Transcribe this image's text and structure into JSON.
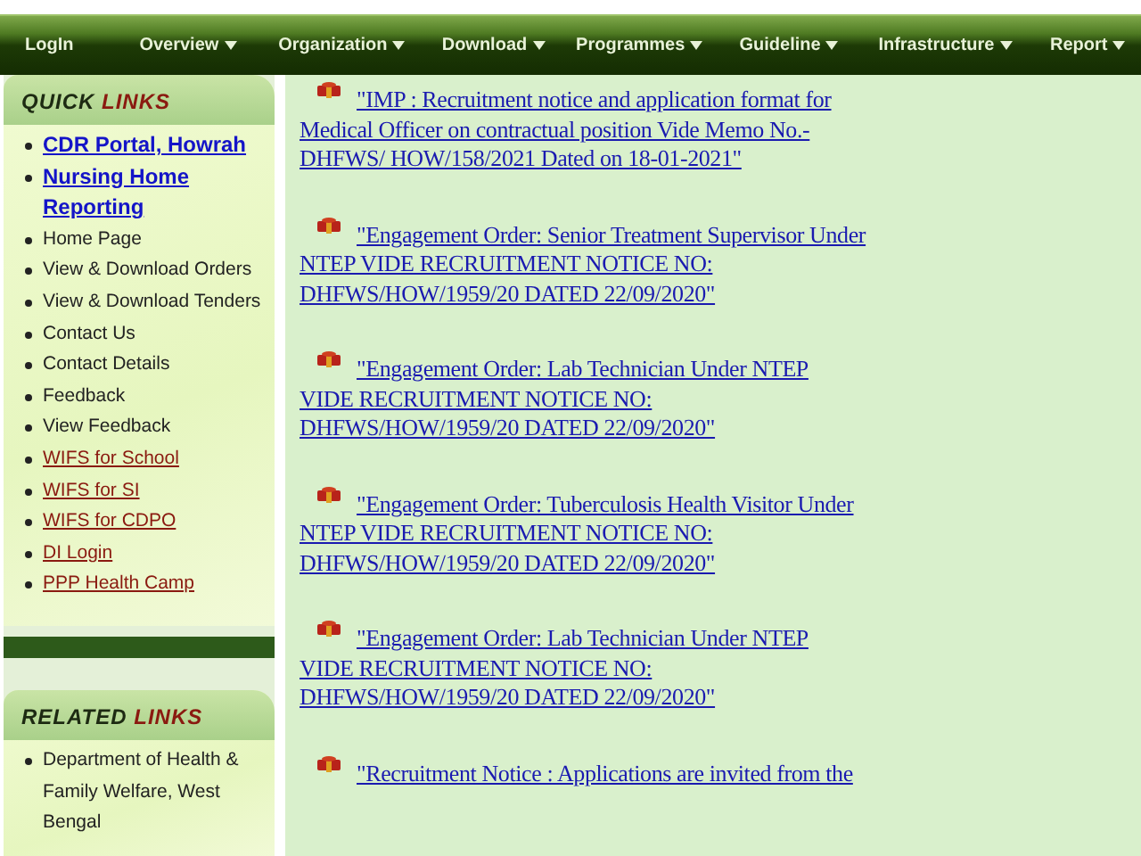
{
  "menu": [
    {
      "label": "LogIn",
      "has_dropdown": false
    },
    {
      "label": "Overview",
      "has_dropdown": true
    },
    {
      "label": "Organization",
      "has_dropdown": true
    },
    {
      "label": "Download",
      "has_dropdown": true
    },
    {
      "label": "Programmes",
      "has_dropdown": true
    },
    {
      "label": "Guideline",
      "has_dropdown": true
    },
    {
      "label": "Infrastructure",
      "has_dropdown": true
    },
    {
      "label": "Report",
      "has_dropdown": true
    }
  ],
  "quick_links": {
    "title": [
      "QUICK",
      "LINKS"
    ],
    "items": [
      {
        "label": "CDR Portal, Howrah",
        "kind": "blue"
      },
      {
        "label": "Nursing Home Reporting",
        "kind": "blue"
      },
      {
        "label": "Home Page",
        "kind": "plain"
      },
      {
        "label": "View & Download Orders",
        "kind": "plain"
      },
      {
        "label": "View & Download Tenders",
        "kind": "plain"
      },
      {
        "label": "Contact Us",
        "kind": "plain"
      },
      {
        "label": "Contact Details",
        "kind": "plain"
      },
      {
        "label": "Feedback",
        "kind": "plain"
      },
      {
        "label": "View Feedback",
        "kind": "plain"
      },
      {
        "label": "WIFS for School",
        "kind": "red"
      },
      {
        "label": "WIFS for SI",
        "kind": "red"
      },
      {
        "label": "WIFS for CDPO",
        "kind": "red"
      },
      {
        "label": "DI Login",
        "kind": "red"
      },
      {
        "label": "PPP Health Camp",
        "kind": "red"
      }
    ]
  },
  "related_links": {
    "title": [
      "RELATED",
      "LINKS"
    ],
    "items": [
      {
        "label": "Department of Health & Family Welfare, West Bengal",
        "kind": "plain"
      }
    ]
  },
  "notices": [
    "\"IMP : Recruitment notice and application format for Medical Officer on contractual position Vide Memo No.- DHFWS/ HOW/158/2021 Dated on 18-01-2021\"",
    "\"Engagement Order: Senior Treatment Supervisor Under NTEP VIDE RECRUITMENT NOTICE NO: DHFWS/HOW/1959/20 DATED 22/09/2020\"",
    "\"Engagement Order: Lab Technician Under NTEP VIDE RECRUITMENT NOTICE NO: DHFWS/HOW/1959/20 DATED 22/09/2020\"",
    "\"Engagement Order: Tuberculosis Health Visitor Under NTEP VIDE RECRUITMENT NOTICE NO: DHFWS/HOW/1959/20 DATED 22/09/2020\"",
    "\"Engagement Order: Lab Technician Under NTEP VIDE RECRUITMENT NOTICE NO: DHFWS/HOW/1959/20 DATED 22/09/2020\"",
    "\"Recruitment Notice : Applications are invited from the"
  ]
}
